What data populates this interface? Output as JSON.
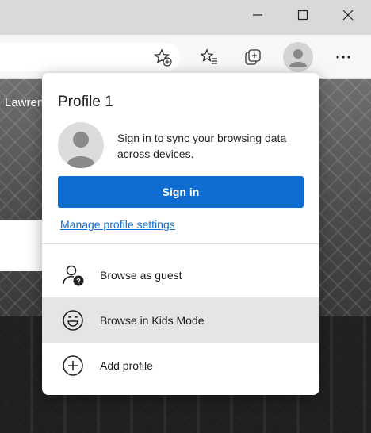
{
  "page_text": {
    "partial_heading": "Lawren"
  },
  "window_controls": {
    "minimize_icon": "minimize-icon",
    "maximize_icon": "maximize-icon",
    "close_icon": "close-icon"
  },
  "toolbar": {
    "favorite_icon": "add-favorite-star-icon",
    "favorites_icon": "favorites-list-icon",
    "collections_icon": "collections-icon",
    "profile_icon": "profile-avatar-icon",
    "more_icon": "more-ellipsis-icon"
  },
  "profile_flyout": {
    "profile_name": "Profile 1",
    "sync_message": "Sign in to sync your browsing data across devices.",
    "signin_label": "Sign in",
    "manage_link": "Manage profile settings",
    "menu_items": [
      {
        "label": "Browse as guest",
        "icon": "guest-icon"
      },
      {
        "label": "Browse in Kids Mode",
        "icon": "kids-mode-smiley-icon"
      },
      {
        "label": "Add profile",
        "icon": "add-profile-plus-icon"
      }
    ]
  },
  "colors": {
    "accent": "#0f6cd0",
    "hover_row": "#e5e5e5"
  }
}
